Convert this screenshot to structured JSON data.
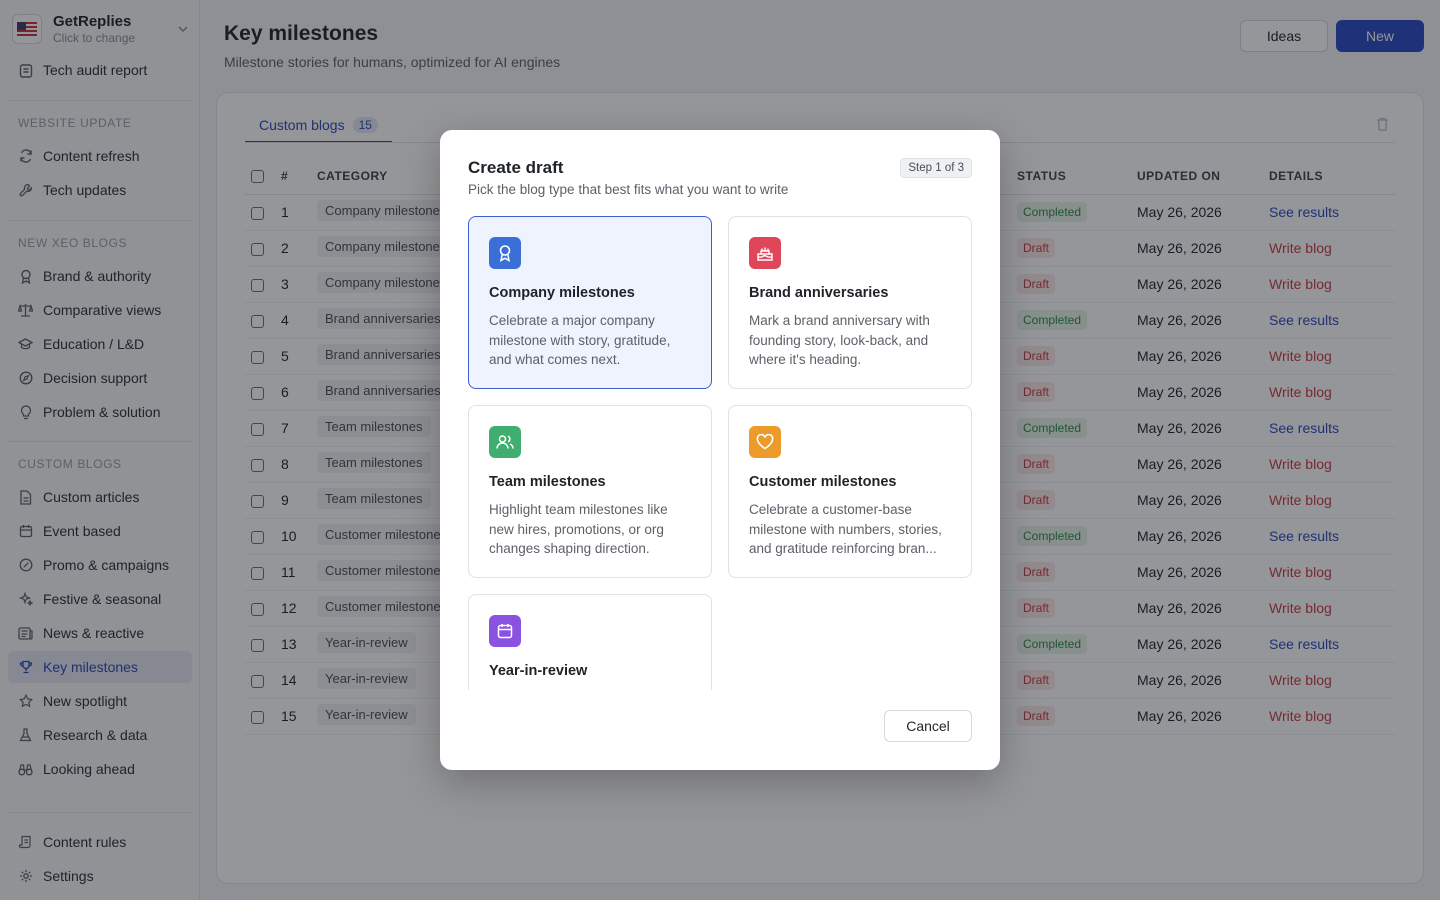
{
  "workspace": {
    "name": "GetReplies",
    "subtitle": "Click to change"
  },
  "sidebar": {
    "top_item": "Tech audit report",
    "sections": [
      {
        "label": "WEBSITE UPDATE",
        "items": [
          "Content refresh",
          "Tech updates"
        ]
      },
      {
        "label": "NEW XEO BLOGS",
        "items": [
          "Brand & authority",
          "Comparative views",
          "Education / L&D",
          "Decision support",
          "Problem & solution"
        ]
      },
      {
        "label": "CUSTOM BLOGS",
        "items": [
          "Custom articles",
          "Event based",
          "Promo & campaigns",
          "Festive & seasonal",
          "News & reactive",
          "Key milestones",
          "New spotlight",
          "Research & data",
          "Looking ahead"
        ]
      }
    ],
    "bottom_items": [
      "Content rules",
      "Settings"
    ],
    "active_item": "Key milestones"
  },
  "header": {
    "title": "Key milestones",
    "subtitle": "Milestone stories for humans, optimized for AI engines",
    "ideas_label": "Ideas",
    "new_label": "New"
  },
  "tabs": [
    {
      "label": "Custom blogs",
      "count": "15"
    }
  ],
  "table": {
    "columns": [
      "#",
      "CATEGORY",
      "STATUS",
      "UPDATED ON",
      "DETAILS"
    ],
    "rows": [
      {
        "num": "1",
        "category": "Company milestones",
        "status": "Completed",
        "updated": "May 26, 2026",
        "details": "See results"
      },
      {
        "num": "2",
        "category": "Company milestones",
        "status": "Draft",
        "updated": "May 26, 2026",
        "details": "Write blog"
      },
      {
        "num": "3",
        "category": "Company milestones",
        "status": "Draft",
        "updated": "May 26, 2026",
        "details": "Write blog"
      },
      {
        "num": "4",
        "category": "Brand anniversaries",
        "status": "Completed",
        "updated": "May 26, 2026",
        "details": "See results"
      },
      {
        "num": "5",
        "category": "Brand anniversaries",
        "status": "Draft",
        "updated": "May 26, 2026",
        "details": "Write blog"
      },
      {
        "num": "6",
        "category": "Brand anniversaries",
        "status": "Draft",
        "updated": "May 26, 2026",
        "details": "Write blog"
      },
      {
        "num": "7",
        "category": "Team milestones",
        "status": "Completed",
        "updated": "May 26, 2026",
        "details": "See results"
      },
      {
        "num": "8",
        "category": "Team milestones",
        "status": "Draft",
        "updated": "May 26, 2026",
        "details": "Write blog"
      },
      {
        "num": "9",
        "category": "Team milestones",
        "status": "Draft",
        "updated": "May 26, 2026",
        "details": "Write blog"
      },
      {
        "num": "10",
        "category": "Customer milestones",
        "status": "Completed",
        "updated": "May 26, 2026",
        "details": "See results"
      },
      {
        "num": "11",
        "category": "Customer milestones",
        "status": "Draft",
        "updated": "May 26, 2026",
        "details": "Write blog"
      },
      {
        "num": "12",
        "category": "Customer milestones",
        "status": "Draft",
        "updated": "May 26, 2026",
        "details": "Write blog"
      },
      {
        "num": "13",
        "category": "Year-in-review",
        "status": "Completed",
        "updated": "May 26, 2026",
        "details": "See results"
      },
      {
        "num": "14",
        "category": "Year-in-review",
        "status": "Draft",
        "updated": "May 26, 2026",
        "details": "Write blog"
      },
      {
        "num": "15",
        "category": "Year-in-review",
        "status": "Draft",
        "updated": "May 26, 2026",
        "details": "Write blog"
      }
    ]
  },
  "modal": {
    "title": "Create draft",
    "subtitle": "Pick the blog type that best fits what you want to write",
    "step": "Step 1 of 3",
    "cancel_label": "Cancel",
    "cards": [
      {
        "title": "Company milestones",
        "description": "Celebrate a major company milestone with story, gratitude, and what comes next.",
        "icon": "award-icon",
        "color": "#3b6fd8",
        "selected": true
      },
      {
        "title": "Brand anniversaries",
        "description": "Mark a brand anniversary with founding story, look-back, and where it's heading.",
        "icon": "cake-icon",
        "color": "#e0465a",
        "selected": false
      },
      {
        "title": "Team milestones",
        "description": "Highlight team milestones like new hires, promotions, or org changes shaping direction.",
        "icon": "users-icon",
        "color": "#3fae6e",
        "selected": false
      },
      {
        "title": "Customer milestones",
        "description": "Celebrate a customer-base milestone with numbers, stories, and gratitude reinforcing bran...",
        "icon": "heart-icon",
        "color": "#ec9a2a",
        "selected": false
      },
      {
        "title": "Year-in-review",
        "description": "",
        "icon": "calendar-icon",
        "color": "#8a52e0",
        "selected": false
      }
    ]
  },
  "colors": {
    "accent": "#2947c4",
    "completed": "#2f8a4a",
    "draft": "#c73b44"
  }
}
